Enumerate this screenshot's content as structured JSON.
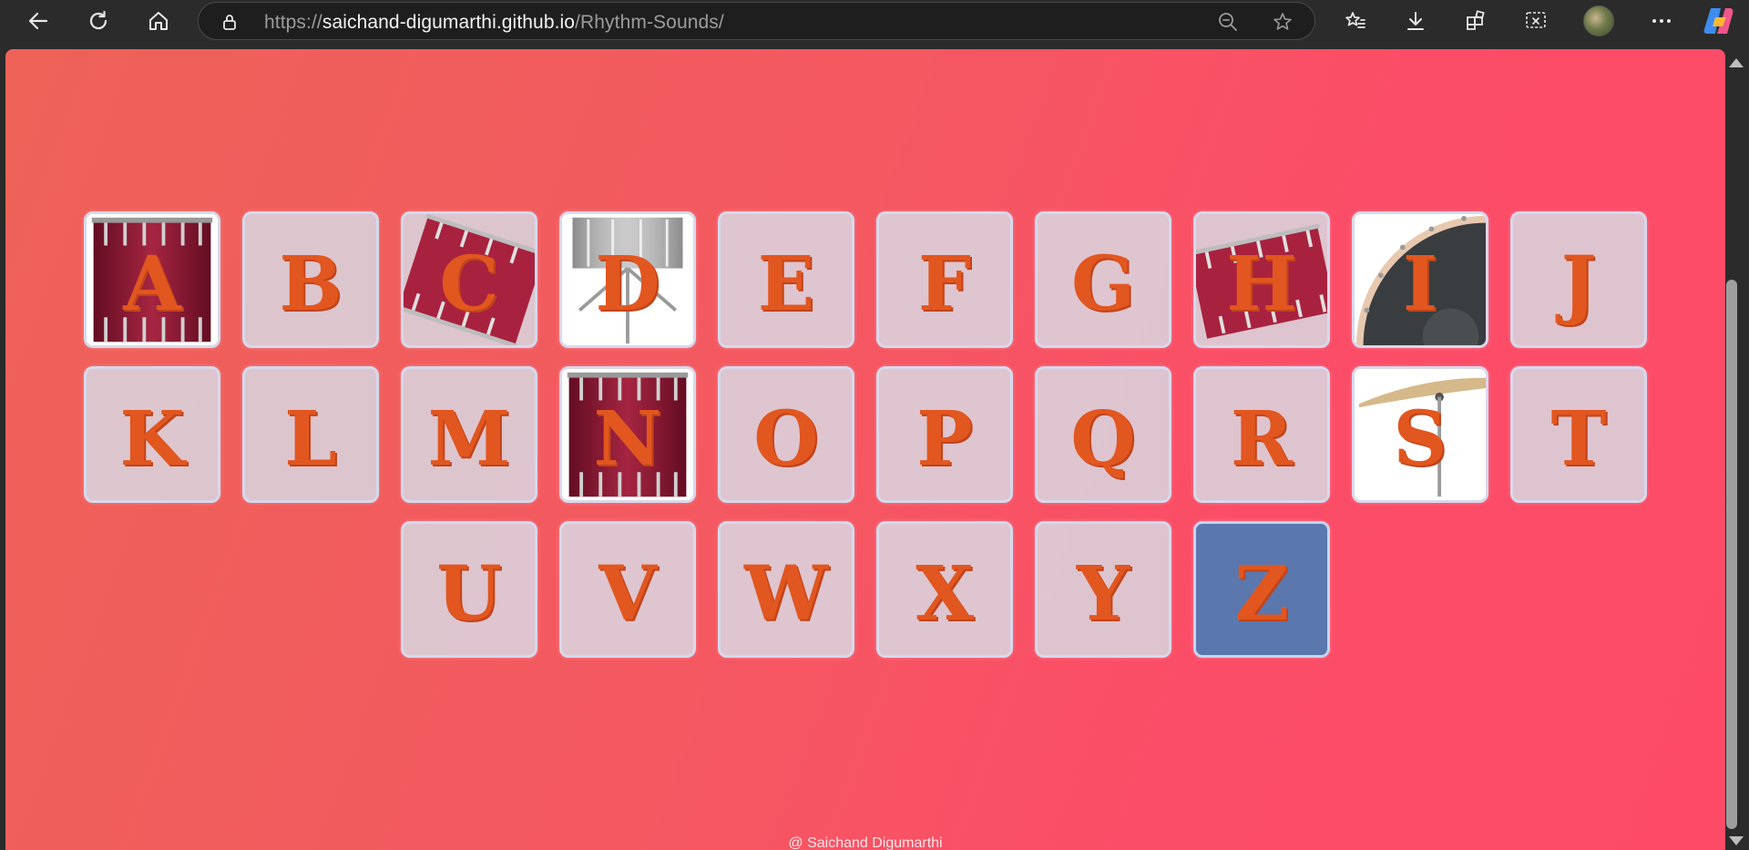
{
  "browser": {
    "url_prefix": "https://",
    "url_host": "saichand-digumarthi.github.io",
    "url_path": "/Rhythm-Sounds/"
  },
  "keys": [
    {
      "letter": "A",
      "art": "drum-front",
      "state": "image"
    },
    {
      "letter": "B",
      "art": "none",
      "state": "plain"
    },
    {
      "letter": "C",
      "art": "drum-tilted",
      "state": "image"
    },
    {
      "letter": "D",
      "art": "snare-stand",
      "state": "image"
    },
    {
      "letter": "E",
      "art": "none",
      "state": "plain"
    },
    {
      "letter": "F",
      "art": "none",
      "state": "plain"
    },
    {
      "letter": "G",
      "art": "none",
      "state": "plain"
    },
    {
      "letter": "H",
      "art": "drum-tilted",
      "state": "image"
    },
    {
      "letter": "I",
      "art": "bass-drum-head",
      "state": "image"
    },
    {
      "letter": "J",
      "art": "none",
      "state": "plain"
    },
    {
      "letter": "K",
      "art": "none",
      "state": "plain"
    },
    {
      "letter": "L",
      "art": "none",
      "state": "plain"
    },
    {
      "letter": "M",
      "art": "none",
      "state": "plain"
    },
    {
      "letter": "N",
      "art": "drum-front",
      "state": "image"
    },
    {
      "letter": "O",
      "art": "none",
      "state": "plain"
    },
    {
      "letter": "P",
      "art": "none",
      "state": "plain"
    },
    {
      "letter": "Q",
      "art": "none",
      "state": "plain"
    },
    {
      "letter": "R",
      "art": "none",
      "state": "plain"
    },
    {
      "letter": "S",
      "art": "cymbal",
      "state": "image"
    },
    {
      "letter": "T",
      "art": "none",
      "state": "plain"
    },
    {
      "letter": "U",
      "art": "none",
      "state": "plain"
    },
    {
      "letter": "V",
      "art": "none",
      "state": "plain"
    },
    {
      "letter": "W",
      "art": "none",
      "state": "plain"
    },
    {
      "letter": "X",
      "art": "none",
      "state": "plain"
    },
    {
      "letter": "Y",
      "art": "none",
      "state": "plain"
    },
    {
      "letter": "Z",
      "art": "none",
      "state": "active"
    }
  ],
  "footer": {
    "credit": "@ Saichand Digumarthi"
  },
  "colors": {
    "letter": "#e2561f",
    "key_bg": "#dccdd7",
    "key_active_bg": "#5a77ae",
    "page_gradient_start": "#ee6258",
    "page_gradient_end": "#fd4b67"
  }
}
